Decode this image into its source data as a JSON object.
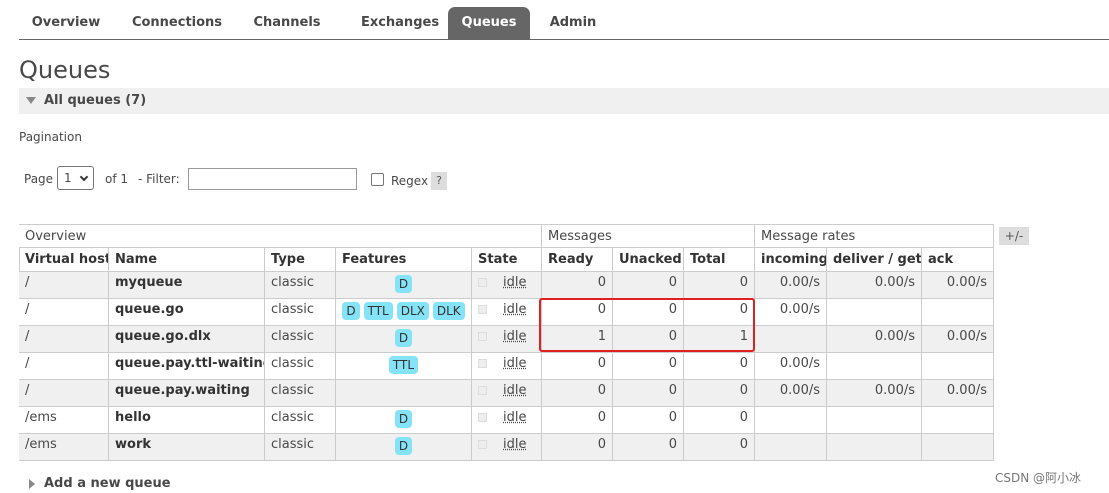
{
  "nav": {
    "tabs": [
      {
        "label": "Overview",
        "active": false
      },
      {
        "label": "Connections",
        "active": false
      },
      {
        "label": "Channels",
        "active": false
      },
      {
        "label": "Exchanges",
        "active": false
      },
      {
        "label": "Queues",
        "active": true
      },
      {
        "label": "Admin",
        "active": false
      }
    ]
  },
  "page_title": "Queues",
  "section": {
    "label": "All queues (7)",
    "icon": "collapse-triangle-icon"
  },
  "pagination": {
    "heading": "Pagination",
    "page_label": "Page",
    "page_value": "1",
    "of_label": "of 1",
    "filter_label": "- Filter:",
    "filter_value": "",
    "regex_label": "Regex",
    "help_label": "?"
  },
  "table": {
    "groups": [
      "Overview",
      "Messages",
      "Message rates"
    ],
    "columns": [
      "Virtual host",
      "Name",
      "Type",
      "Features",
      "State",
      "Ready",
      "Unacked",
      "Total",
      "incoming",
      "deliver / get",
      "ack"
    ],
    "toggle_label": "+/-",
    "rows": [
      {
        "vhost": "/",
        "name": "myqueue",
        "type": "classic",
        "features": [
          "D"
        ],
        "state": "idle",
        "ready": "0",
        "unacked": "0",
        "total": "0",
        "incoming": "0.00/s",
        "deliver": "0.00/s",
        "ack": "0.00/s"
      },
      {
        "vhost": "/",
        "name": "queue.go",
        "type": "classic",
        "features": [
          "D",
          "TTL",
          "DLX",
          "DLK"
        ],
        "state": "idle",
        "ready": "0",
        "unacked": "0",
        "total": "0",
        "incoming": "0.00/s",
        "deliver": "",
        "ack": ""
      },
      {
        "vhost": "/",
        "name": "queue.go.dlx",
        "type": "classic",
        "features": [
          "D"
        ],
        "state": "idle",
        "ready": "1",
        "unacked": "0",
        "total": "1",
        "incoming": "",
        "deliver": "0.00/s",
        "ack": "0.00/s"
      },
      {
        "vhost": "/",
        "name": "queue.pay.ttl-waiting",
        "type": "classic",
        "features": [
          "TTL"
        ],
        "state": "idle",
        "ready": "0",
        "unacked": "0",
        "total": "0",
        "incoming": "0.00/s",
        "deliver": "",
        "ack": ""
      },
      {
        "vhost": "/",
        "name": "queue.pay.waiting",
        "type": "classic",
        "features": [],
        "state": "idle",
        "ready": "0",
        "unacked": "0",
        "total": "0",
        "incoming": "0.00/s",
        "deliver": "0.00/s",
        "ack": "0.00/s"
      },
      {
        "vhost": "/ems",
        "name": "hello",
        "type": "classic",
        "features": [
          "D"
        ],
        "state": "idle",
        "ready": "0",
        "unacked": "0",
        "total": "0",
        "incoming": "",
        "deliver": "",
        "ack": ""
      },
      {
        "vhost": "/ems",
        "name": "work",
        "type": "classic",
        "features": [
          "D"
        ],
        "state": "idle",
        "ready": "0",
        "unacked": "0",
        "total": "0",
        "incoming": "",
        "deliver": "",
        "ack": ""
      }
    ]
  },
  "add_queue": {
    "label": "Add a new queue",
    "icon": "expand-triangle-icon"
  },
  "watermark": "CSDN @阿小冰",
  "colors": {
    "active_tab": "#666666",
    "feature_badge": "#85e3f7",
    "highlight_box": "#e02020"
  }
}
